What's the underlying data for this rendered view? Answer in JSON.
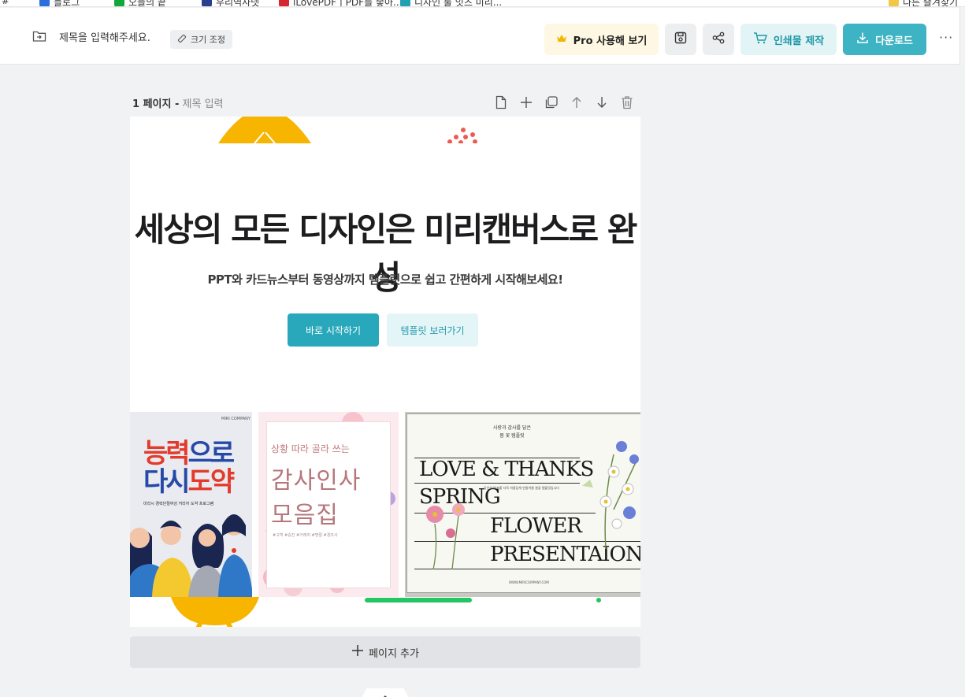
{
  "bookmarks": [
    {
      "label": "#",
      "color": "#999999"
    },
    {
      "label": "블로그",
      "color": "#2a6ddc"
    },
    {
      "label": "오늘의 끝",
      "color": "#11a83b"
    },
    {
      "label": "우리역사넷",
      "color": "#2b3f8f"
    },
    {
      "label": "iLovePDF | PDF를 좋아...",
      "color": "#d6262e"
    },
    {
      "label": "디자인 툴 잇츠 미리...",
      "color": "#21a0b2"
    },
    {
      "label": "다른 즐겨찾기",
      "color": "#f2c744"
    }
  ],
  "toolbar": {
    "title_placeholder": "제목을 입력해주세요.",
    "resize_label": "크기 조정",
    "pro_label": "Pro 사용해 보기",
    "print_label": "인쇄물 제작",
    "download_label": "다운로드",
    "more_label": "···"
  },
  "page": {
    "number_label": "1 페이지 -",
    "title_placeholder": "제목 입력"
  },
  "canvas": {
    "hero_title": "세상의 모든 디자인은 미리캔버스로 완성",
    "hero_subtitle": "PPT와 카드뉴스부터 동영상까지 템플릿으로 쉽고 간편하게 시작해보세요!",
    "cta_start": "바로 시작하기",
    "cta_templates": "템플릿 보러가기",
    "card1": {
      "logo": "MIRI COMPANY",
      "title_a": "능력",
      "title_b": "으로",
      "title_c": "다시",
      "title_d": "도약",
      "subtitle": "미리시 경력단절여성 커리어 도약 프로그램"
    },
    "card2": {
      "small": "상황 따라 골라 쓰는",
      "big1": "감사인사",
      "big2": "모음집",
      "tags": "#고객 #승진 #거래처 #명절 #경조사"
    },
    "card3": {
      "top_line1": "사랑과 감사를 담은",
      "top_line2": "봄 꽃 템플릿",
      "line1": "LOVE & THANKS",
      "line2": "SPRING",
      "line3": "FLOWER",
      "line4": "PRESENTAION",
      "mini": "당신의 발표를 더욱 아름답게 만들어줄 봄꽃 템플릿입니다",
      "url": "WWW.MIRICOMPANY.COM"
    }
  },
  "add_page_label": "페이지 추가",
  "colors": {
    "accent": "#3eb3c3",
    "cta": "#28a8ba",
    "pro_bg": "#fdf7e3",
    "crown": "#f2b705"
  }
}
